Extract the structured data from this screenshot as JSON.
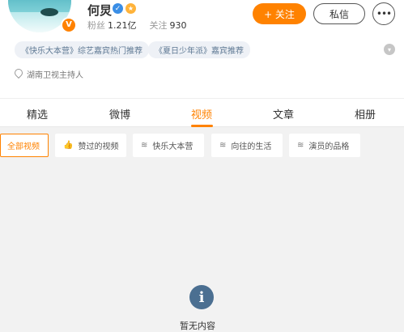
{
  "profile": {
    "name": "何炅",
    "verified_badge": "V",
    "stats": {
      "fans_label": "粉丝",
      "fans_value": "1.21亿",
      "following_label": "关注",
      "following_value": "930"
    },
    "follow_label": "+ 关注",
    "message_label": "私信",
    "more_label": "•••",
    "tags": [
      "《快乐大本营》综艺嘉宾热门推荐",
      "《夏日少年派》嘉宾推荐"
    ],
    "location_text": "湖南卫视主持人"
  },
  "tabs": [
    "精选",
    "微博",
    "视频",
    "文章",
    "相册"
  ],
  "active_tab": "视频",
  "filters": [
    {
      "label": "全部视频",
      "icon": ""
    },
    {
      "label": "赞过的视频",
      "icon": "thumb-up-icon"
    },
    {
      "label": "快乐大本营",
      "icon": "layers-icon"
    },
    {
      "label": "向往的生活",
      "icon": "layers-icon"
    },
    {
      "label": "演员的品格",
      "icon": "layers-icon"
    }
  ],
  "empty_state": {
    "icon": "info-icon",
    "text": "暂无内容"
  },
  "colors": {
    "accent": "#ff8200",
    "tag_text": "#5d7893",
    "tag_bg": "#eef1f6",
    "page_bg": "#f2f2f2",
    "info_icon": "#4b6f91"
  }
}
